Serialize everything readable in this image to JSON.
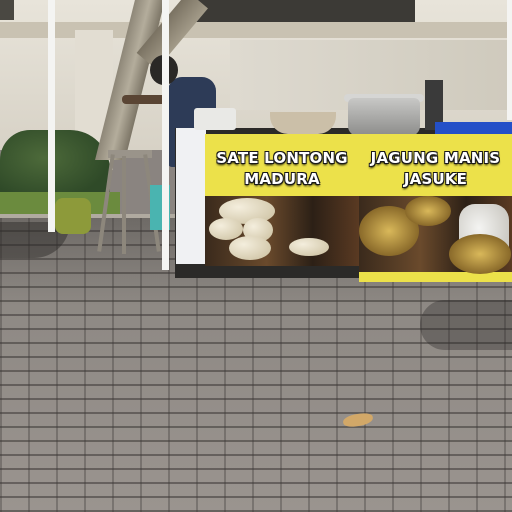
{
  "scene": {
    "description_role": "street food stall photo"
  },
  "banners": {
    "left": {
      "line1": "SATE LONTONG",
      "line2": "MADURA"
    },
    "right": {
      "line1": "JAGUNG MANIS",
      "line2": "JASUKE"
    }
  },
  "colors": {
    "banner_yellow": "#ece14a",
    "text_white": "#ffffff",
    "text_outline": "#1a1a1a",
    "paving": "#8a8580",
    "tent_pole": "#f4f4f2"
  }
}
